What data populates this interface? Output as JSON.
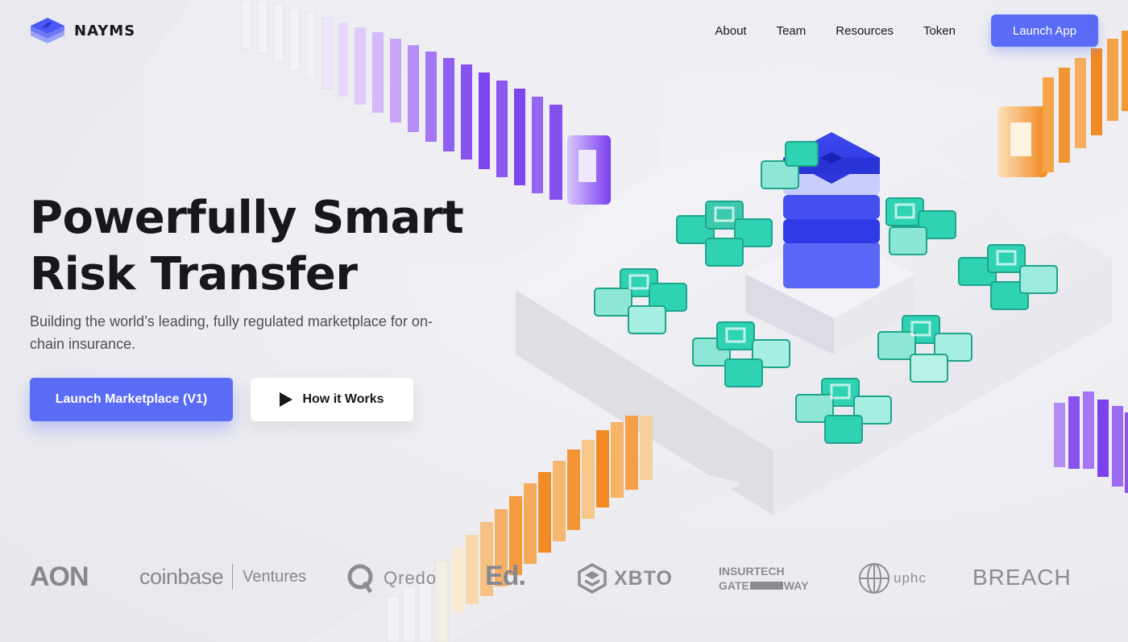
{
  "brand": {
    "name": "NAYMS"
  },
  "nav": {
    "links": [
      "About",
      "Team",
      "Resources",
      "Token"
    ],
    "cta": "Launch App"
  },
  "hero": {
    "title_line1": "Powerfully Smart",
    "title_line2": "Risk Transfer",
    "subtitle": "Building the world’s leading, fully regulated marketplace for on-chain insurance.",
    "primary_button": "Launch Marketplace (V1)",
    "secondary_button": "How it Works"
  },
  "partners": {
    "aon": "AON",
    "coinbase": "coinbase",
    "coinbase_suffix": "Ventures",
    "qredo": "Qredo",
    "ed": "Ed.",
    "xbto": "XBTO",
    "insurtech_line1": "INSURTECH",
    "insurtech_gate": "GATE",
    "insurtech_way": "WAY",
    "uphc": "uphc",
    "breach": "BREACH"
  },
  "colors": {
    "accent": "#5a6cf5",
    "teal": "#2ed3b7",
    "purple": "#8a4ff0",
    "orange": "#f59a2c"
  }
}
